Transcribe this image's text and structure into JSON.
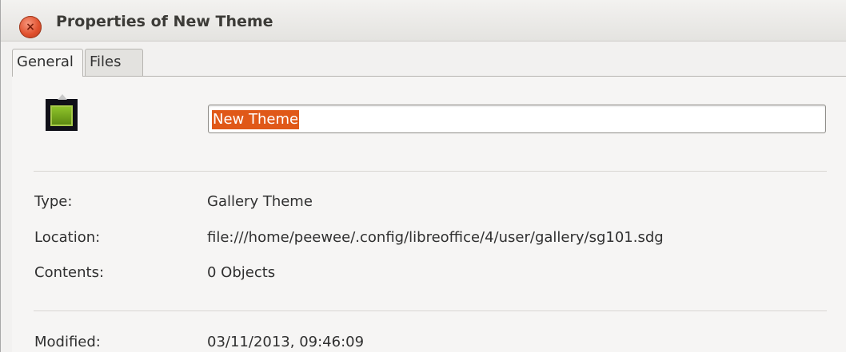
{
  "window": {
    "title": "Properties of New Theme",
    "close_glyph": "×"
  },
  "tabs": [
    {
      "label": "General",
      "active": true
    },
    {
      "label": "Files",
      "active": false
    }
  ],
  "general": {
    "theme_icon": "gallery-theme-icon",
    "name_value": "New Theme",
    "fields": {
      "type": {
        "label": "Type:",
        "value": "Gallery Theme"
      },
      "location": {
        "label": "Location:",
        "value": "file:///home/peewee/.config/libreoffice/4/user/gallery/sg101.sdg"
      },
      "contents": {
        "label": "Contents:",
        "value": "0 Objects"
      },
      "modified": {
        "label": "Modified:",
        "value": "03/11/2013, 09:46:09"
      }
    }
  },
  "colors": {
    "accent_selection": "#e05818",
    "close_button": "#e0502d"
  }
}
